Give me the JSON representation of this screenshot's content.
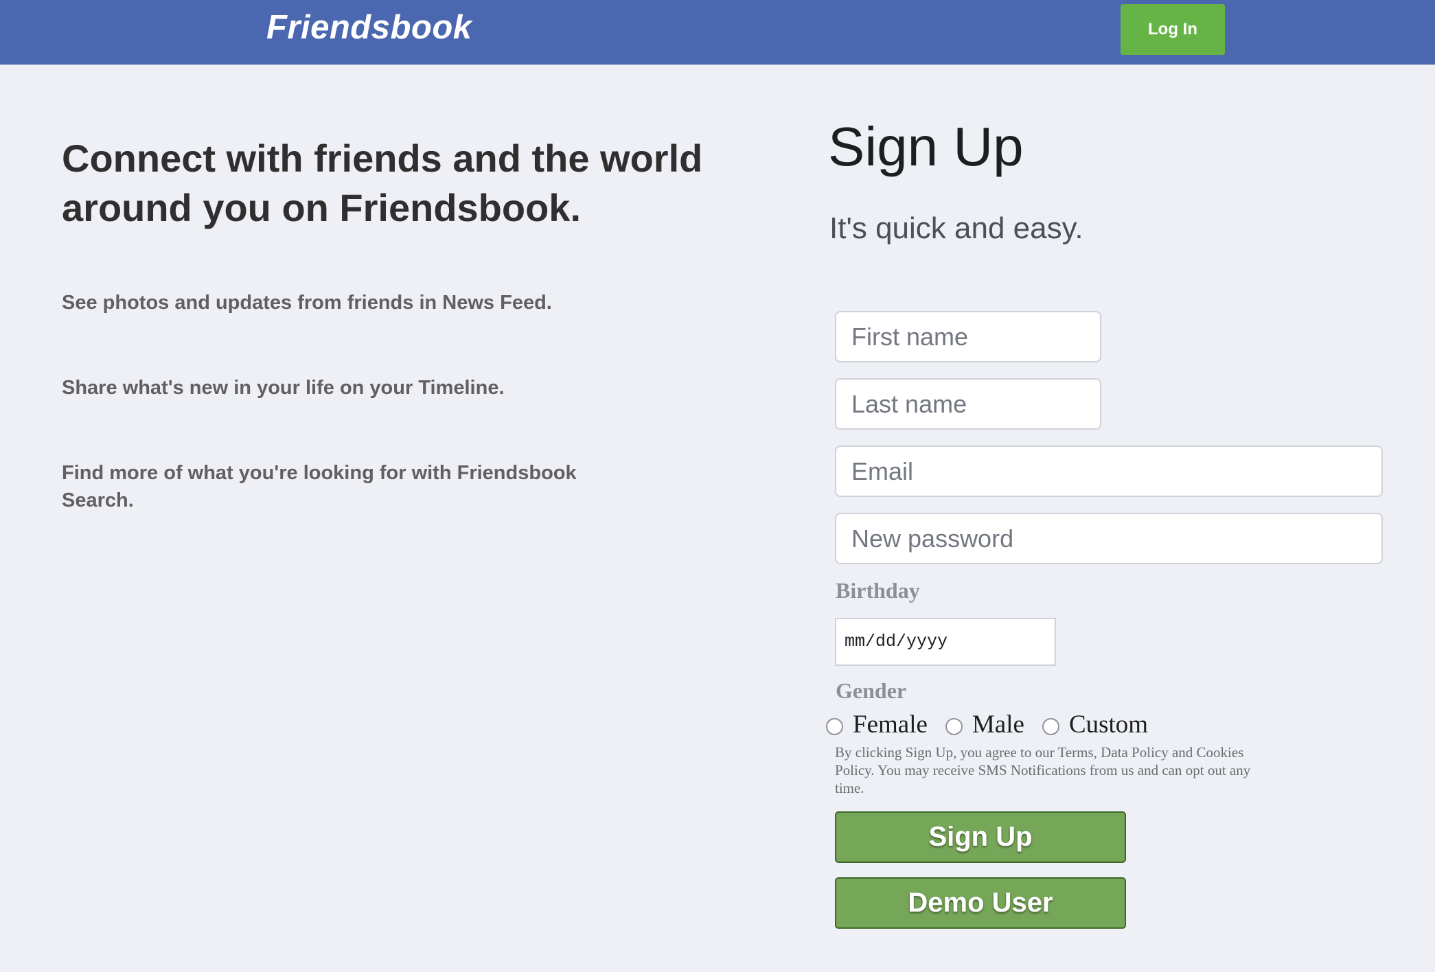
{
  "header": {
    "logo": "Friendsbook",
    "login_label": "Log In"
  },
  "intro": {
    "headline": "Connect with friends and the world around you on Friendsbook.",
    "features": [
      "See photos and updates from friends in News Feed.",
      "Share what's new in your life on your Timeline.",
      "Find more of what you're looking for with Friendsbook Search."
    ]
  },
  "signup": {
    "title": "Sign Up",
    "subtitle": "It's quick and easy.",
    "first_name_placeholder": "First name",
    "last_name_placeholder": "Last name",
    "email_placeholder": "Email",
    "password_placeholder": "New password",
    "birthday_label": "Birthday",
    "birthday_placeholder": "mm/dd/yyyy",
    "gender_label": "Gender",
    "gender_options": [
      "Female",
      "Male",
      "Custom"
    ],
    "terms": "By clicking Sign Up, you agree to our Terms, Data Policy and Cookies Policy. You may receive SMS Notifications from us and can opt out any time.",
    "signup_button": "Sign Up",
    "demo_button": "Demo User"
  },
  "colors": {
    "header_bg": "#4a67b0",
    "login_green": "#66b445",
    "button_green": "#76a658",
    "page_bg": "#eff0f5"
  }
}
